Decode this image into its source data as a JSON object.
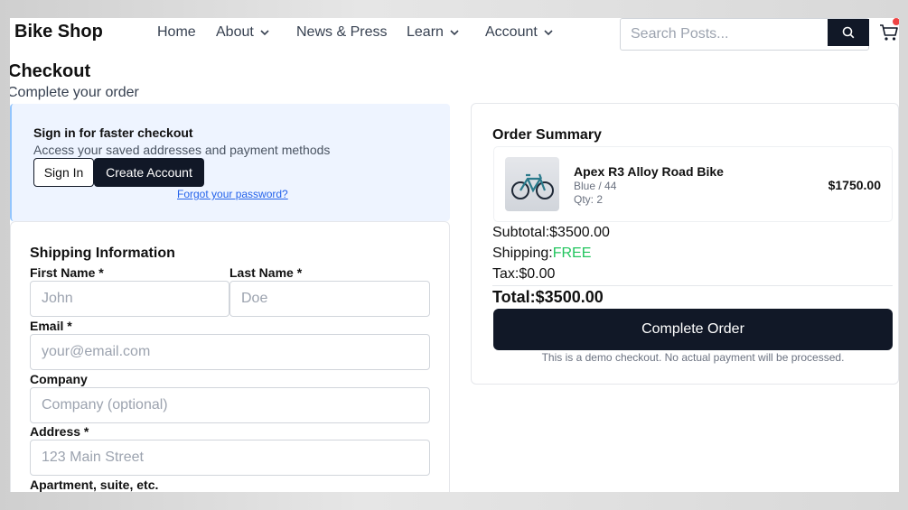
{
  "nav": {
    "brand": "Bike Shop",
    "links": [
      "Home",
      "About",
      "News & Press",
      "Learn",
      "Account"
    ],
    "search_placeholder": "Search Posts..."
  },
  "checkout": {
    "title": "Checkout",
    "subtitle": "Complete your order"
  },
  "signin": {
    "title": "Sign in for faster checkout",
    "description": "Access your saved addresses and payment methods",
    "signin_label": "Sign In",
    "create_label": "Create Account",
    "forgot_label": "Forgot your password?"
  },
  "shipping": {
    "title": "Shipping Information",
    "first_name_label": "First Name *",
    "first_name_placeholder": "John",
    "last_name_label": "Last Name *",
    "last_name_placeholder": "Doe",
    "email_label": "Email *",
    "email_placeholder": "your@email.com",
    "company_label": "Company",
    "company_placeholder": "Company (optional)",
    "address_label": "Address *",
    "address_placeholder": "123 Main Street",
    "apartment_label": "Apartment, suite, etc."
  },
  "summary": {
    "title": "Order Summary",
    "item": {
      "name": "Apex R3 Alloy Road Bike",
      "variant": "Blue / 44",
      "qty": "Qty: 2",
      "price": "$1750.00"
    },
    "subtotal_label": "Subtotal:",
    "subtotal_value": "$3500.00",
    "shipping_label": "Shipping:",
    "shipping_value": "FREE",
    "tax_label": "Tax:",
    "tax_value": "$0.00",
    "total_label": "Total:",
    "total_value": "$3500.00",
    "complete_label": "Complete Order",
    "demo_note": "This is a demo checkout. No actual payment will be processed."
  },
  "colors": {
    "primary": "#111827",
    "free": "#22c55e",
    "link": "#2563eb",
    "signin_bg": "#eef4ff"
  }
}
